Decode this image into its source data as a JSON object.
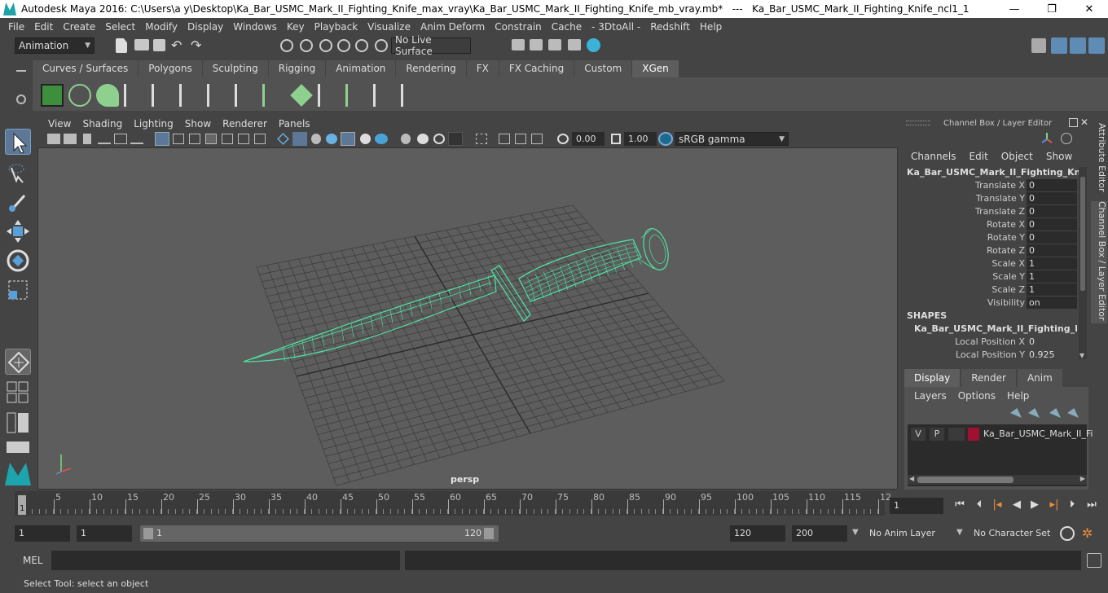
{
  "window": {
    "title": "Autodesk Maya 2016: C:\\Users\\a y\\Desktop\\Ka_Bar_USMC_Mark_II_Fighting_Knife_max_vray\\Ka_Bar_USMC_Mark_II_Fighting_Knife_mb_vray.mb*   ---   Ka_Bar_USMC_Mark_II_Fighting_Knife_ncl1_1",
    "minimize": "—",
    "maximize": "❐",
    "close": "✕"
  },
  "menu": [
    "File",
    "Edit",
    "Create",
    "Select",
    "Modify",
    "Display",
    "Windows",
    "Key",
    "Playback",
    "Visualize",
    "Anim Deform",
    "Constrain",
    "Cache",
    "- 3DtoAll -",
    "Redshift",
    "Help"
  ],
  "status": {
    "mode": "Animation",
    "live_surface": "No Live Surface"
  },
  "shelf": {
    "tabs": [
      "Curves / Surfaces",
      "Polygons",
      "Sculpting",
      "Rigging",
      "Animation",
      "Rendering",
      "FX",
      "FX Caching",
      "Custom",
      "XGen"
    ],
    "active": "XGen"
  },
  "panel": {
    "menu": [
      "View",
      "Shading",
      "Lighting",
      "Show",
      "Renderer",
      "Panels"
    ],
    "exposure": "0.00",
    "gamma": "1.00",
    "color_space": "sRGB gamma",
    "camera": "persp"
  },
  "channel_box": {
    "title": "Channel Box / Layer Editor",
    "menu": [
      "Channels",
      "Edit",
      "Object",
      "Show"
    ],
    "object": "Ka_Bar_USMC_Mark_II_Fighting_Knife...",
    "attributes": [
      {
        "label": "Translate X",
        "value": "0"
      },
      {
        "label": "Translate Y",
        "value": "0"
      },
      {
        "label": "Translate Z",
        "value": "0"
      },
      {
        "label": "Rotate X",
        "value": "0"
      },
      {
        "label": "Rotate Y",
        "value": "0"
      },
      {
        "label": "Rotate Z",
        "value": "0"
      },
      {
        "label": "Scale X",
        "value": "1"
      },
      {
        "label": "Scale Y",
        "value": "1"
      },
      {
        "label": "Scale Z",
        "value": "1"
      },
      {
        "label": "Visibility",
        "value": "on"
      }
    ],
    "shapes_header": "SHAPES",
    "shape_name": "Ka_Bar_USMC_Mark_II_Fighting_Kni...",
    "shape_attributes": [
      {
        "label": "Local Position X",
        "value": "0"
      },
      {
        "label": "Local Position Y",
        "value": "0.925"
      }
    ]
  },
  "side_tabs": [
    "Attribute Editor",
    "Channel Box / Layer Editor"
  ],
  "layer_editor": {
    "tabs": [
      "Display",
      "Render",
      "Anim"
    ],
    "active": "Display",
    "menu": [
      "Layers",
      "Options",
      "Help"
    ],
    "layer": {
      "v": "V",
      "p": "P",
      "name": "Ka_Bar_USMC_Mark_II_Fi",
      "color": "#a01030"
    }
  },
  "timeline": {
    "ticks": [
      "5",
      "10",
      "15",
      "20",
      "25",
      "30",
      "35",
      "40",
      "45",
      "50",
      "55",
      "60",
      "65",
      "70",
      "75",
      "80",
      "85",
      "90",
      "95",
      "100",
      "105",
      "110",
      "115",
      "12"
    ],
    "start_marker": "1",
    "current_frame": "1"
  },
  "range": {
    "start": "1",
    "start_inner": "1",
    "slider_start": "1",
    "slider_end": "120",
    "end_inner": "120",
    "end": "200",
    "anim_layer": "No Anim Layer",
    "character_set": "No Character Set"
  },
  "mel": {
    "label": "MEL"
  },
  "help_line": "Select Tool: select an object"
}
